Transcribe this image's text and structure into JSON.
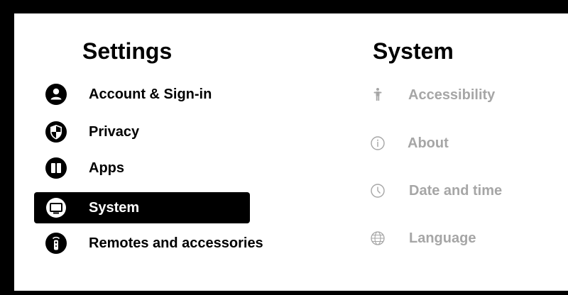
{
  "settings": {
    "title": "Settings",
    "items": [
      {
        "label": "Account & Sign-in",
        "icon": "account-icon",
        "selected": false
      },
      {
        "label": "Privacy",
        "icon": "privacy-shield-icon",
        "selected": false
      },
      {
        "label": "Apps",
        "icon": "apps-icon",
        "selected": false
      },
      {
        "label": "System",
        "icon": "system-tv-icon",
        "selected": true
      },
      {
        "label": "Remotes and accessories",
        "icon": "remote-icon",
        "selected": false
      }
    ]
  },
  "system": {
    "title": "System",
    "items": [
      {
        "label": "Accessibility",
        "icon": "accessibility-icon"
      },
      {
        "label": "About",
        "icon": "info-icon"
      },
      {
        "label": "Date and time",
        "icon": "clock-icon"
      },
      {
        "label": "Language",
        "icon": "globe-icon"
      }
    ]
  },
  "colors": {
    "frame": "#000000",
    "background": "#ffffff",
    "text": "#000000",
    "selected_bg": "#000000",
    "selected_text": "#ffffff",
    "muted_text": "#a6a6a6"
  }
}
